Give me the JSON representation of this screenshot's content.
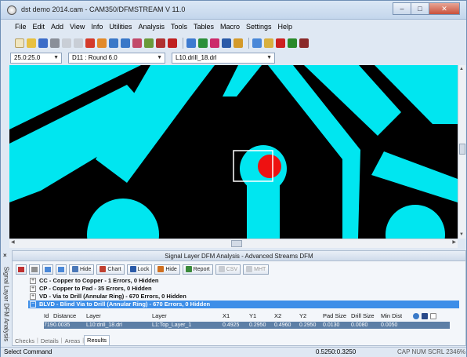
{
  "window": {
    "title": "dst demo 2014.cam - CAM350/DFMSTREAM V 11.0",
    "controls": [
      "–",
      "□",
      "✕"
    ]
  },
  "menu": [
    "File",
    "Edit",
    "Add",
    "View",
    "Info",
    "Utilities",
    "Analysis",
    "Tools",
    "Tables",
    "Macro",
    "Settings",
    "Help"
  ],
  "selectors": {
    "grid": "25.0:25.0",
    "dcode": "D11 : Round 6.0",
    "layer": "L10.drill_18.drl"
  },
  "panel": {
    "title": "Signal Layer DFM Analysis - Advanced Streams DFM",
    "toolbar": {
      "hide1": "Hide",
      "chart": "Chart",
      "lock": "Lock",
      "hide2": "Hide",
      "report": "Report",
      "csv": "CSV",
      "mht": "MHT"
    },
    "side_label": "Signal Layer DFM Analysis",
    "tree": [
      {
        "text": "CC - Copper to Copper - 1 Errors, 0 Hidden",
        "selected": false
      },
      {
        "text": "CP - Copper to Pad - 35 Errors, 0 Hidden",
        "selected": false
      },
      {
        "text": "VD - Via to Drill (Annular Ring) - 670 Errors, 0 Hidden",
        "selected": false
      },
      {
        "text": "BLVD - Blind Via to Drill (Annular Ring) - 670 Errors, 0 Hidden",
        "selected": true
      }
    ],
    "grid": {
      "headers": [
        "Id",
        "Distance",
        "Layer",
        "Layer",
        "X1",
        "Y1",
        "X2",
        "Y2",
        "Pad Size",
        "Drill Size",
        "Min Dist"
      ],
      "row": [
        "719",
        "0.0035",
        "L10:drill_18.drl",
        "L1:Top_Layer_1",
        "0.4925",
        "0.2950",
        "0.4960",
        "0.2950",
        "0.0130",
        "0.0080",
        "0.0050"
      ]
    },
    "tabs": [
      "Checks",
      "Details",
      "Areas",
      "Results"
    ]
  },
  "status": {
    "command": "Select Command",
    "coords": "0.5250:0.3250",
    "indicators": "CAP  NUM  SCRL  2346%"
  },
  "colors": {
    "copper": "#00e6f0",
    "background": "#000000",
    "error_marker": "#ee1111",
    "selected_row": "#3d8ee8",
    "grid_row": "#5d7fa6"
  },
  "icons": [
    "app-icon",
    "new-icon",
    "open-icon",
    "save-icon",
    "print-icon",
    "undo-icon",
    "redo-icon",
    "zoom-icon",
    "pan-icon",
    "select-icon",
    "delete-icon",
    "refresh-icon",
    "layers-icon"
  ]
}
